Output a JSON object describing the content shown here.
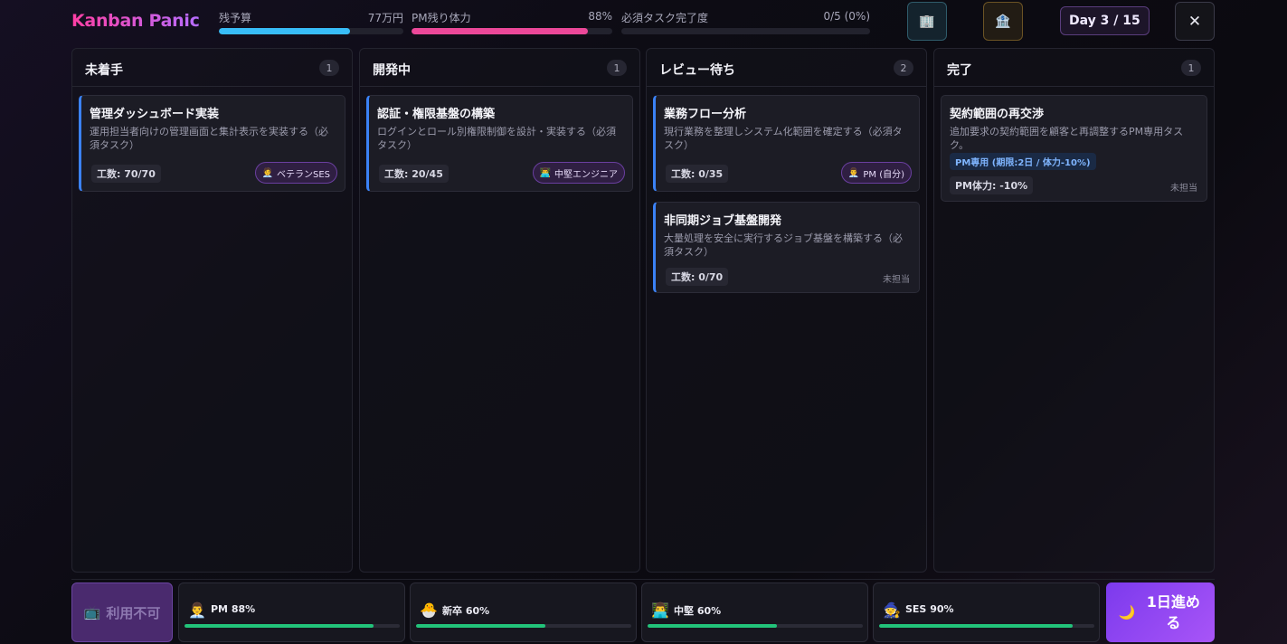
{
  "app": {
    "title": "Kanban Panic"
  },
  "header": {
    "meters": [
      {
        "label": "残予算",
        "value": "77万円",
        "fill_pct": 71,
        "color": "#38bdf8"
      },
      {
        "label": "PM残り体力",
        "value": "88%",
        "fill_pct": 88,
        "color": "#ec4899"
      },
      {
        "label": "必須タスク完了度",
        "value": "0/5 (0%)",
        "fill_pct": 0,
        "color": "#22c55e"
      }
    ],
    "company_icon": "🏢",
    "bank_icon": "🏦",
    "day": "Day 3 / 15",
    "close_icon": "✕"
  },
  "columns": [
    {
      "title": "未着手",
      "count": "1",
      "cards": [
        {
          "title": "管理ダッシュボード実装",
          "desc": "運用担当者向けの管理画面と集計表示を実装する（必須タスク）",
          "effort": "工数: 70/70",
          "assignee_icon": "🧑‍💼",
          "assignee": "ベテランSES"
        }
      ]
    },
    {
      "title": "開発中",
      "count": "1",
      "cards": [
        {
          "title": "認証・権限基盤の構築",
          "desc": "ログインとロール別権限制御を設計・実装する（必須タスク）",
          "effort": "工数: 20/45",
          "assignee_icon": "👨‍💻",
          "assignee": "中堅エンジニア"
        }
      ]
    },
    {
      "title": "レビュー待ち",
      "count": "2",
      "cards": [
        {
          "title": "業務フロー分析",
          "desc": "現行業務を整理しシステム化範囲を確定する（必須タスク）",
          "effort": "工数: 0/35",
          "assignee_icon": "👨‍💼",
          "assignee": "PM (自分)"
        },
        {
          "title": "非同期ジョブ基盤開発",
          "desc": "大量処理を安全に実行するジョブ基盤を構築する（必須タスク）",
          "effort": "工数: 0/70",
          "assignee": "未担当"
        }
      ]
    },
    {
      "title": "完了",
      "count": "1",
      "cards": [
        {
          "title": "契約範囲の再交渉",
          "desc": "追加要求の契約範囲を顧客と再調整するPM専用タスク。",
          "tag": "PM専用 (期限:2日 / 体力-10%)",
          "effort": "PM体力: -10%",
          "assignee": "未担当"
        }
      ]
    }
  ],
  "footer": {
    "unavailable_icon": "📺",
    "unavailable_label": "利用不可",
    "members": [
      {
        "icon": "👨‍💼",
        "label": "PM 88%",
        "fill_pct": 88
      },
      {
        "icon": "🐣",
        "label": "新卒 60%",
        "fill_pct": 60
      },
      {
        "icon": "👨‍💻",
        "label": "中堅 60%",
        "fill_pct": 60
      },
      {
        "icon": "🧙",
        "label": "SES 90%",
        "fill_pct": 90
      }
    ],
    "advance_icon": "🌙",
    "advance_label": "1日進める"
  }
}
